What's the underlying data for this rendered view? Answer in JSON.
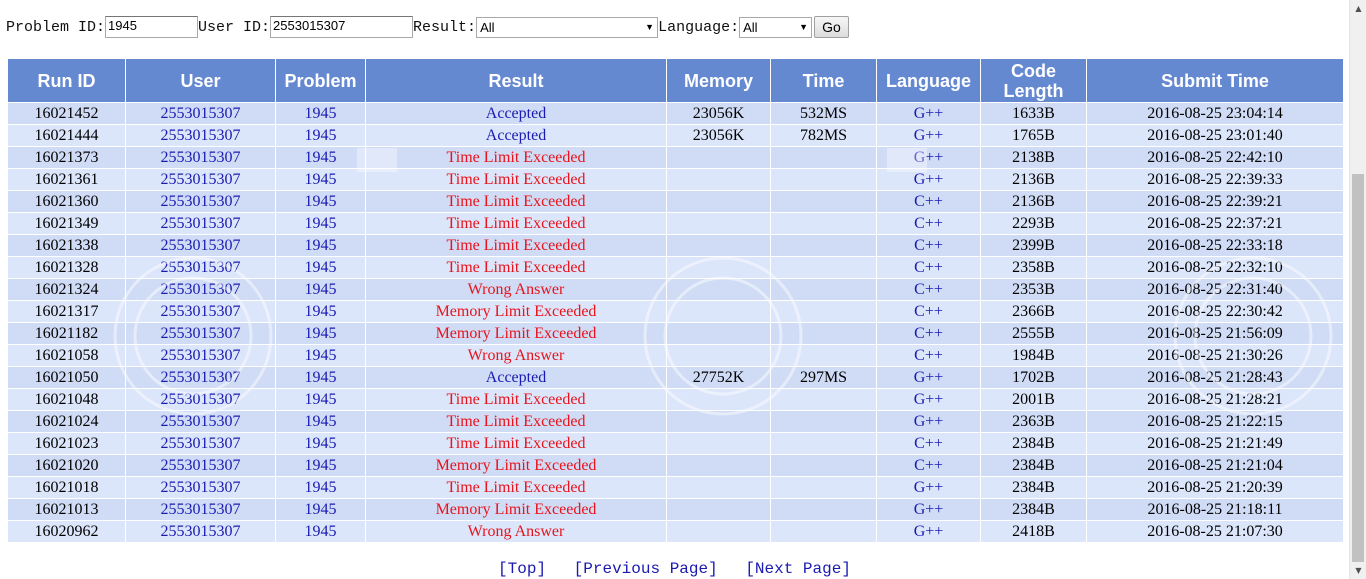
{
  "filters": {
    "problem_label": "Problem ID:",
    "problem_value": "1945",
    "user_label": "User ID:",
    "user_value": "2553015307",
    "result_label": "Result:",
    "result_value": "All",
    "language_label": "Language:",
    "language_value": "All",
    "go_label": "Go"
  },
  "table": {
    "headers": [
      "Run ID",
      "User",
      "Problem",
      "Result",
      "Memory",
      "Time",
      "Language",
      "Code Length",
      "Submit Time"
    ],
    "rows": [
      {
        "run_id": "16021452",
        "user": "2553015307",
        "problem": "1945",
        "result": "Accepted",
        "status": "accepted",
        "memory": "23056K",
        "time": "532MS",
        "language": "G++",
        "code_length": "1633B",
        "submit_time": "2016-08-25 23:04:14"
      },
      {
        "run_id": "16021444",
        "user": "2553015307",
        "problem": "1945",
        "result": "Accepted",
        "status": "accepted",
        "memory": "23056K",
        "time": "782MS",
        "language": "G++",
        "code_length": "1765B",
        "submit_time": "2016-08-25 23:01:40"
      },
      {
        "run_id": "16021373",
        "user": "2553015307",
        "problem": "1945",
        "result": "Time Limit Exceeded",
        "status": "error",
        "memory": "",
        "time": "",
        "language": "G++",
        "code_length": "2138B",
        "submit_time": "2016-08-25 22:42:10"
      },
      {
        "run_id": "16021361",
        "user": "2553015307",
        "problem": "1945",
        "result": "Time Limit Exceeded",
        "status": "error",
        "memory": "",
        "time": "",
        "language": "G++",
        "code_length": "2136B",
        "submit_time": "2016-08-25 22:39:33"
      },
      {
        "run_id": "16021360",
        "user": "2553015307",
        "problem": "1945",
        "result": "Time Limit Exceeded",
        "status": "error",
        "memory": "",
        "time": "",
        "language": "C++",
        "code_length": "2136B",
        "submit_time": "2016-08-25 22:39:21"
      },
      {
        "run_id": "16021349",
        "user": "2553015307",
        "problem": "1945",
        "result": "Time Limit Exceeded",
        "status": "error",
        "memory": "",
        "time": "",
        "language": "C++",
        "code_length": "2293B",
        "submit_time": "2016-08-25 22:37:21"
      },
      {
        "run_id": "16021338",
        "user": "2553015307",
        "problem": "1945",
        "result": "Time Limit Exceeded",
        "status": "error",
        "memory": "",
        "time": "",
        "language": "C++",
        "code_length": "2399B",
        "submit_time": "2016-08-25 22:33:18"
      },
      {
        "run_id": "16021328",
        "user": "2553015307",
        "problem": "1945",
        "result": "Time Limit Exceeded",
        "status": "error",
        "memory": "",
        "time": "",
        "language": "C++",
        "code_length": "2358B",
        "submit_time": "2016-08-25 22:32:10"
      },
      {
        "run_id": "16021324",
        "user": "2553015307",
        "problem": "1945",
        "result": "Wrong Answer",
        "status": "error",
        "memory": "",
        "time": "",
        "language": "C++",
        "code_length": "2353B",
        "submit_time": "2016-08-25 22:31:40"
      },
      {
        "run_id": "16021317",
        "user": "2553015307",
        "problem": "1945",
        "result": "Memory Limit Exceeded",
        "status": "error",
        "memory": "",
        "time": "",
        "language": "C++",
        "code_length": "2366B",
        "submit_time": "2016-08-25 22:30:42"
      },
      {
        "run_id": "16021182",
        "user": "2553015307",
        "problem": "1945",
        "result": "Memory Limit Exceeded",
        "status": "error",
        "memory": "",
        "time": "",
        "language": "C++",
        "code_length": "2555B",
        "submit_time": "2016-08-25 21:56:09"
      },
      {
        "run_id": "16021058",
        "user": "2553015307",
        "problem": "1945",
        "result": "Wrong Answer",
        "status": "error",
        "memory": "",
        "time": "",
        "language": "C++",
        "code_length": "1984B",
        "submit_time": "2016-08-25 21:30:26"
      },
      {
        "run_id": "16021050",
        "user": "2553015307",
        "problem": "1945",
        "result": "Accepted",
        "status": "accepted",
        "memory": "27752K",
        "time": "297MS",
        "language": "G++",
        "code_length": "1702B",
        "submit_time": "2016-08-25 21:28:43"
      },
      {
        "run_id": "16021048",
        "user": "2553015307",
        "problem": "1945",
        "result": "Time Limit Exceeded",
        "status": "error",
        "memory": "",
        "time": "",
        "language": "G++",
        "code_length": "2001B",
        "submit_time": "2016-08-25 21:28:21"
      },
      {
        "run_id": "16021024",
        "user": "2553015307",
        "problem": "1945",
        "result": "Time Limit Exceeded",
        "status": "error",
        "memory": "",
        "time": "",
        "language": "G++",
        "code_length": "2363B",
        "submit_time": "2016-08-25 21:22:15"
      },
      {
        "run_id": "16021023",
        "user": "2553015307",
        "problem": "1945",
        "result": "Time Limit Exceeded",
        "status": "error",
        "memory": "",
        "time": "",
        "language": "C++",
        "code_length": "2384B",
        "submit_time": "2016-08-25 21:21:49"
      },
      {
        "run_id": "16021020",
        "user": "2553015307",
        "problem": "1945",
        "result": "Memory Limit Exceeded",
        "status": "error",
        "memory": "",
        "time": "",
        "language": "C++",
        "code_length": "2384B",
        "submit_time": "2016-08-25 21:21:04"
      },
      {
        "run_id": "16021018",
        "user": "2553015307",
        "problem": "1945",
        "result": "Time Limit Exceeded",
        "status": "error",
        "memory": "",
        "time": "",
        "language": "G++",
        "code_length": "2384B",
        "submit_time": "2016-08-25 21:20:39"
      },
      {
        "run_id": "16021013",
        "user": "2553015307",
        "problem": "1945",
        "result": "Memory Limit Exceeded",
        "status": "error",
        "memory": "",
        "time": "",
        "language": "G++",
        "code_length": "2384B",
        "submit_time": "2016-08-25 21:18:11"
      },
      {
        "run_id": "16020962",
        "user": "2553015307",
        "problem": "1945",
        "result": "Wrong Answer",
        "status": "error",
        "memory": "",
        "time": "",
        "language": "G++",
        "code_length": "2418B",
        "submit_time": "2016-08-25 21:07:30"
      }
    ]
  },
  "pager": {
    "top": "[Top]",
    "previous": "[Previous Page]",
    "next": "[Next Page]"
  },
  "colors": {
    "header_bg": "#6589d1",
    "row_bg": "#c8d6f4",
    "link": "#1a1ab0",
    "error": "#e8131b"
  },
  "icons": {
    "scroll_up": "triangle-up",
    "scroll_down": "triangle-down",
    "select_caret": "triangle-down"
  }
}
